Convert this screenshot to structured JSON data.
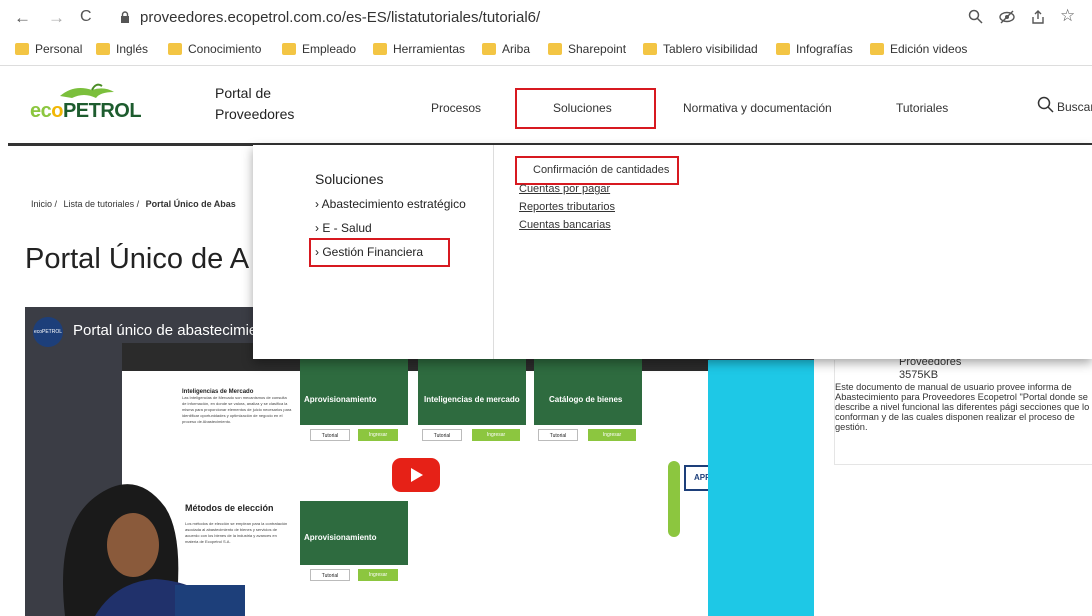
{
  "browser": {
    "url": "proveedores.ecopetrol.com.co/es-ES/listatutoriales/tutorial6/",
    "back": "←",
    "forward": "→",
    "reload": "C",
    "bookmarks": [
      "Personal",
      "Inglés",
      "Conocimiento",
      "Empleado",
      "Herramientas",
      "Ariba",
      "Sharepoint",
      "Tablero visibilidad",
      "Infografías",
      "Edición videos"
    ]
  },
  "header": {
    "logo_text": "ECOPETROL",
    "portal_title_line1": "Portal de",
    "portal_title_line2": "Proveedores",
    "nav": [
      "Procesos",
      "Soluciones",
      "Normativa y documentación",
      "Tutoriales"
    ],
    "search_label": "Buscar"
  },
  "dropdown": {
    "heading": "Soluciones",
    "items": [
      "Abastecimiento estratégico",
      "E - Salud",
      "Gestión Financiera"
    ],
    "links": [
      "Confirmación de cantidades",
      "Cuentas por pagar",
      "Reportes tributarios",
      "Cuentas bancarias"
    ]
  },
  "breadcrumb": {
    "home": "Inicio /",
    "list": "Lista de tutoriales /",
    "current": "Portal Único de Abas"
  },
  "page_title": "Portal Único de A",
  "video": {
    "title": "Portal único de abastecimien",
    "channel_badge": "ecoPETROL",
    "inner_heading_1": "Inteligencias de Mercado",
    "inner_para_1": "Las Inteligencias de Mercado son mecanismos de consulta de información, en donde se valora, analiza y se clasifica la misma para proporcionar elementos de juicio necesarios para identificar oportunidades y optimización de negocio en el proceso de Abastecimiento.",
    "cards": [
      "Aprovisionamiento",
      "Inteligencias de mercado",
      "Catálogo de bienes"
    ],
    "btn_tutorial": "Tutorial",
    "btn_ingresar": "Ingresar",
    "inner_heading_2": "Métodos de elección",
    "inner_para_2": "Los métodos de elección se emplean para la contratación asociada al abastecimiento de bienes y servicios de acuerdo con los bienes de la industria y avances en materia de Ecopetrol S.A.",
    "card_bottom": "Aprovisionamiento",
    "side_label": "APROVISIONAMIENTO"
  },
  "doc_card": {
    "title_partial": "Proveedores",
    "size": "3575KB",
    "description": "Este documento de manual de usuario provee informa de Abastecimiento para Proveedores Ecopetrol \"Portal donde se describe a nivel funcional las diferentes pági secciones que lo conforman y de las cuales disponen realizar el proceso de gestión."
  },
  "colors": {
    "brand_green": "#2a6b2f",
    "highlight_red": "#d71920",
    "youtube_red": "#e62117",
    "cyan_panel": "#1ec8e6",
    "lime": "#8cc63f"
  }
}
